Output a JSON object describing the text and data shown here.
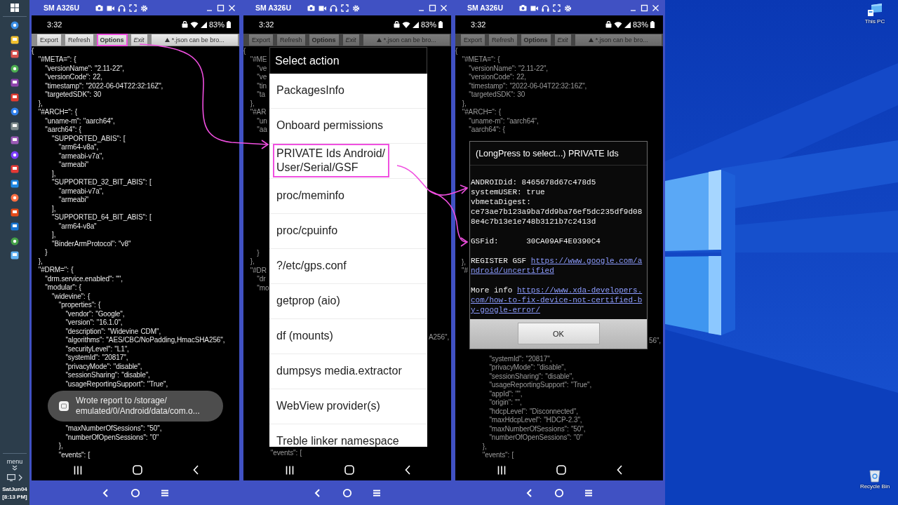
{
  "taskbar": {
    "menu_label": "menu",
    "date": "SatJun04",
    "time": "[8:13 PM]"
  },
  "phones": [
    {
      "title": "SM A326U",
      "time": "3:32",
      "battery": "83%",
      "dimmed": false,
      "toolbar": [
        {
          "label": "Export",
          "kind": "plain",
          "highlighted": false
        },
        {
          "label": "Refresh",
          "kind": "plain",
          "highlighted": false
        },
        {
          "label": "Options",
          "kind": "bold",
          "highlighted": true
        },
        {
          "label": "Exit",
          "kind": "italic",
          "highlighted": false
        },
        {
          "label": "*.json can be bro...",
          "kind": "notice",
          "highlighted": false
        }
      ],
      "code_above": [
        "{",
        "   \"#META=\": {",
        "      \"versionName\": \"2.11-22\",",
        "      \"versionCode\": 22,",
        "      \"timestamp\": \"2022-06-04T22:32:16Z\",",
        "      \"targetedSDK\": 30",
        "   },",
        "   \"#ARCH=\": {",
        "      \"uname-m\": \"aarch64\",",
        "      \"aarch64\": {",
        "         \"SUPPORTED_ABIS\": [",
        "            \"arm64-v8a\",",
        "            \"armeabi-v7a\",",
        "            \"armeabi\"",
        "         ],",
        "         \"SUPPORTED_32_BIT_ABIS\": [",
        "            \"armeabi-v7a\",",
        "            \"armeabi\"",
        "         ],",
        "         \"SUPPORTED_64_BIT_ABIS\": [",
        "            \"arm64-v8a\"",
        "         ],",
        "         \"BinderArmProtocol\": \"v8\"",
        "      }",
        "   },",
        "   \"#DRM=\": {",
        "      \"drm.service.enabled\": \"\",",
        "      \"modular\": {",
        "         \"widevine\": {",
        "            \"properties\": {",
        "               \"vendor\": \"Google\",",
        "               \"version\": \"16.1.0\",",
        "               \"description\": \"Widevine CDM\",",
        "               \"algorithms\": \"AES/CBC/NoPadding,HmacSHA256\",",
        "               \"securityLevel\": \"L1\",",
        "               \"systemId\": \"20817\",",
        "               \"privacyMode\": \"disable\",",
        "               \"sessionSharing\": \"disable\",",
        "               \"usageReportingSupport\": \"True\","
      ],
      "overlay": {
        "kind": "toast",
        "message": "Wrote report to /storage/\nemulated/0/Android/data/com.o..."
      },
      "code_below": [
        "               \"maxNumberOfSessions\": \"50\",",
        "               \"numberOfOpenSessions\": \"0\"",
        "            },",
        "            \"events\": ["
      ]
    },
    {
      "title": "SM A326U",
      "time": "3:32",
      "battery": "83%",
      "dimmed": true,
      "toolbar": [
        {
          "label": "Export",
          "kind": "plain",
          "highlighted": false
        },
        {
          "label": "Refresh",
          "kind": "plain",
          "highlighted": false
        },
        {
          "label": "Options",
          "kind": "bold",
          "highlighted": false
        },
        {
          "label": "Exit",
          "kind": "italic",
          "highlighted": false
        },
        {
          "label": "*.json can be bro...",
          "kind": "notice",
          "highlighted": false
        }
      ],
      "side_left": [
        [
          "{",
          "   \"#ME",
          "      \"ve",
          "      \"ve",
          "      \"tin",
          "      \"ta",
          "   },",
          "   \"#AR",
          "      \"un",
          "      \"aa"
        ],
        [
          "      }",
          "   },",
          "   \"#DR",
          "      \"dr",
          "      \"mo"
        ]
      ],
      "overlay": {
        "kind": "action_menu",
        "title": "Select action",
        "items": [
          {
            "label": "PackagesInfo",
            "highlighted": false
          },
          {
            "label": "Onboard permissions",
            "highlighted": false
          },
          {
            "label": "PRIVATE Ids Android/\nUser/Serial/GSF",
            "highlighted": true
          },
          {
            "label": "proc/meminfo",
            "highlighted": false
          },
          {
            "label": "proc/cpuinfo",
            "highlighted": false
          },
          {
            "label": "?/etc/gps.conf",
            "highlighted": false
          },
          {
            "label": "getprop (aio)",
            "highlighted": false
          },
          {
            "label": "df (mounts)",
            "highlighted": false
          },
          {
            "label": "dumpsys media.extractor",
            "highlighted": false
          },
          {
            "label": "WebView provider(s)",
            "highlighted": false
          },
          {
            "label": "Treble linker namespace",
            "highlighted": false
          }
        ]
      },
      "side_right": [
        "A256\","
      ],
      "code_below": [
        "            \"events\": ["
      ]
    },
    {
      "title": "SM A326U",
      "time": "3:32",
      "battery": "83%",
      "dimmed": true,
      "toolbar": [
        {
          "label": "Export",
          "kind": "plain",
          "highlighted": false
        },
        {
          "label": "Refresh",
          "kind": "plain",
          "highlighted": false
        },
        {
          "label": "Options",
          "kind": "bold",
          "highlighted": false
        },
        {
          "label": "Exit",
          "kind": "italic",
          "highlighted": false
        },
        {
          "label": "*.json can be bro...",
          "kind": "notice",
          "highlighted": false
        }
      ],
      "code_above": [
        "{",
        "   \"#META=\": {",
        "      \"versionName\": \"2.11-22\",",
        "      \"versionCode\": 22,",
        "      \"timestamp\": \"2022-06-04T22:32:16Z\",",
        "      \"targetedSDK\": 30",
        "   },",
        "   \"#ARCH=\": {",
        "      \"uname-m\": \"aarch64\",",
        "      \"aarch64\": {"
      ],
      "side_left": [
        [
          "},",
          "\"#"
        ]
      ],
      "overlay": {
        "kind": "message_dialog",
        "title": "(LongPress to select...) PRIVATE Ids",
        "sections": [
          [
            {
              "kind": "text",
              "text": "ANDROIDid: 8465678d67c478d5"
            },
            {
              "kind": "text",
              "text": "systemUSER: true"
            },
            {
              "kind": "text",
              "text": "vbmetaDigest:"
            },
            {
              "kind": "text",
              "text": "ce73ae7b123a9ba7dd9ba76ef5dc235df9d088e4c7b13e1e748b3121b7c2413d"
            }
          ],
          [
            {
              "kind": "text",
              "text": "GSFid:      30CA09AF4E0390C4"
            }
          ],
          [
            {
              "kind": "link",
              "label": "REGISTER GSF",
              "url": "https://www.google.com/android/uncertified"
            }
          ],
          [
            {
              "kind": "link",
              "label": "More info",
              "url": "https://www.xda-developers.com/how-to-fix-device-not-certified-by-google-error/"
            }
          ]
        ],
        "button": "OK"
      },
      "side_right": [
        "56\","
      ],
      "code_below": [
        "               \"systemId\": \"20817\",",
        "               \"privacyMode\": \"disable\",",
        "               \"sessionSharing\": \"disable\",",
        "               \"usageReportingSupport\": \"True\",",
        "               \"appId\": \"\",",
        "               \"origin\": \"\",",
        "               \"hdcpLevel\": \"Disconnected\",",
        "               \"maxHdcpLevel\": \"HDCP-2.3\",",
        "               \"maxNumberOfSessions\": \"50\",",
        "               \"numberOfOpenSessions\": \"0\"",
        "            },",
        "            \"events\": ["
      ]
    }
  ],
  "desktop": {
    "icons": [
      {
        "label": "This PC",
        "kind": "computer"
      },
      {
        "label": "Recycle Bin",
        "kind": "recycle_bin"
      }
    ]
  }
}
